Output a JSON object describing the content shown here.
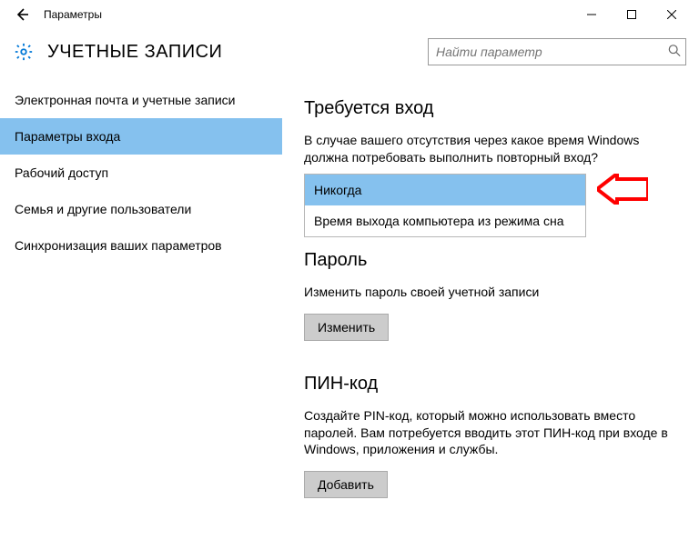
{
  "titlebar": {
    "title": "Параметры"
  },
  "header": {
    "title": "УЧЕТНЫЕ ЗАПИСИ",
    "search_placeholder": "Найти параметр"
  },
  "sidebar": {
    "items": [
      {
        "label": "Электронная почта и учетные записи",
        "active": false
      },
      {
        "label": "Параметры входа",
        "active": true
      },
      {
        "label": "Рабочий доступ",
        "active": false
      },
      {
        "label": "Семья и другие пользователи",
        "active": false
      },
      {
        "label": "Синхронизация ваших параметров",
        "active": false
      }
    ]
  },
  "main": {
    "signin": {
      "heading": "Требуется вход",
      "description": "В случае вашего отсутствия через какое время Windows должна потребовать выполнить повторный вход?",
      "options": [
        {
          "label": "Никогда",
          "selected": true
        },
        {
          "label": "Время выхода компьютера из режима сна",
          "selected": false
        }
      ]
    },
    "password": {
      "heading": "Пароль",
      "description": "Изменить пароль своей учетной записи",
      "button": "Изменить"
    },
    "pin": {
      "heading": "ПИН-код",
      "description": "Создайте PIN-код, который можно использовать вместо паролей. Вам потребуется вводить этот ПИН-код при входе в Windows, приложения и службы.",
      "button": "Добавить"
    }
  }
}
